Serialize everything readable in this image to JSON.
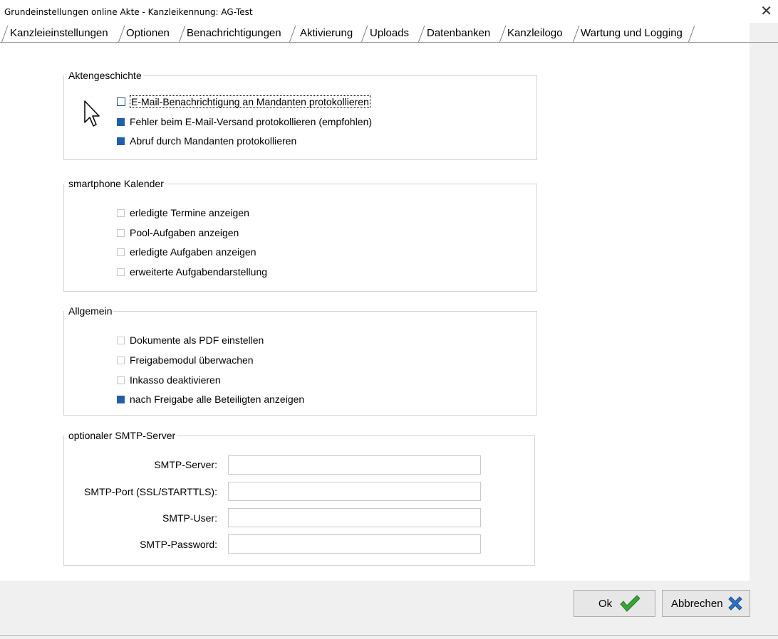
{
  "window": {
    "title": "Grundeinstellungen online Akte - Kanzleikennung: AG-Test",
    "close_glyph": "✕"
  },
  "tabs": [
    {
      "label": "Kanzleieinstellungen"
    },
    {
      "label": "Optionen"
    },
    {
      "label": "Benachrichtigungen"
    },
    {
      "label": "Aktivierung"
    },
    {
      "label": "Uploads"
    },
    {
      "label": "Datenbanken"
    },
    {
      "label": "Kanzleilogo"
    },
    {
      "label": "Wartung und Logging"
    }
  ],
  "active_tab": "Optionen",
  "groups": {
    "aktengeschichte": {
      "legend": "Aktengeschichte",
      "items": [
        {
          "label": "E-Mail-Benachrichtigung an Mandanten protokollieren",
          "checked": false
        },
        {
          "label": "Fehler beim E-Mail-Versand protokollieren (empfohlen)",
          "checked": true
        },
        {
          "label": "Abruf durch Mandanten protokollieren",
          "checked": true
        }
      ]
    },
    "kalender": {
      "legend": "smartphone Kalender",
      "items": [
        {
          "label": "erledigte Termine anzeigen",
          "checked": false
        },
        {
          "label": "Pool-Aufgaben anzeigen",
          "checked": false
        },
        {
          "label": "erledigte Aufgaben anzeigen",
          "checked": false
        },
        {
          "label": "erweiterte Aufgabendarstellung",
          "checked": false
        }
      ]
    },
    "allgemein": {
      "legend": "Allgemein",
      "items": [
        {
          "label": "Dokumente als PDF einstellen",
          "checked": false
        },
        {
          "label": "Freigabemodul überwachen",
          "checked": false
        },
        {
          "label": "Inkasso deaktivieren",
          "checked": false
        },
        {
          "label": "nach Freigabe alle Beteiligten anzeigen",
          "checked": true
        }
      ]
    },
    "smtp": {
      "legend": "optionaler SMTP-Server",
      "fields": [
        {
          "label": "SMTP-Server:",
          "value": ""
        },
        {
          "label": "SMTP-Port (SSL/STARTTLS):",
          "value": ""
        },
        {
          "label": "SMTP-User:",
          "value": ""
        },
        {
          "label": "SMTP-Password:",
          "value": ""
        }
      ]
    }
  },
  "buttons": {
    "ok": "Ok",
    "cancel": "Abbrechen"
  },
  "colors": {
    "checked": "#1f5fa9",
    "ok_icon": "#3aa335",
    "cancel_icon": "#2f72c4"
  }
}
